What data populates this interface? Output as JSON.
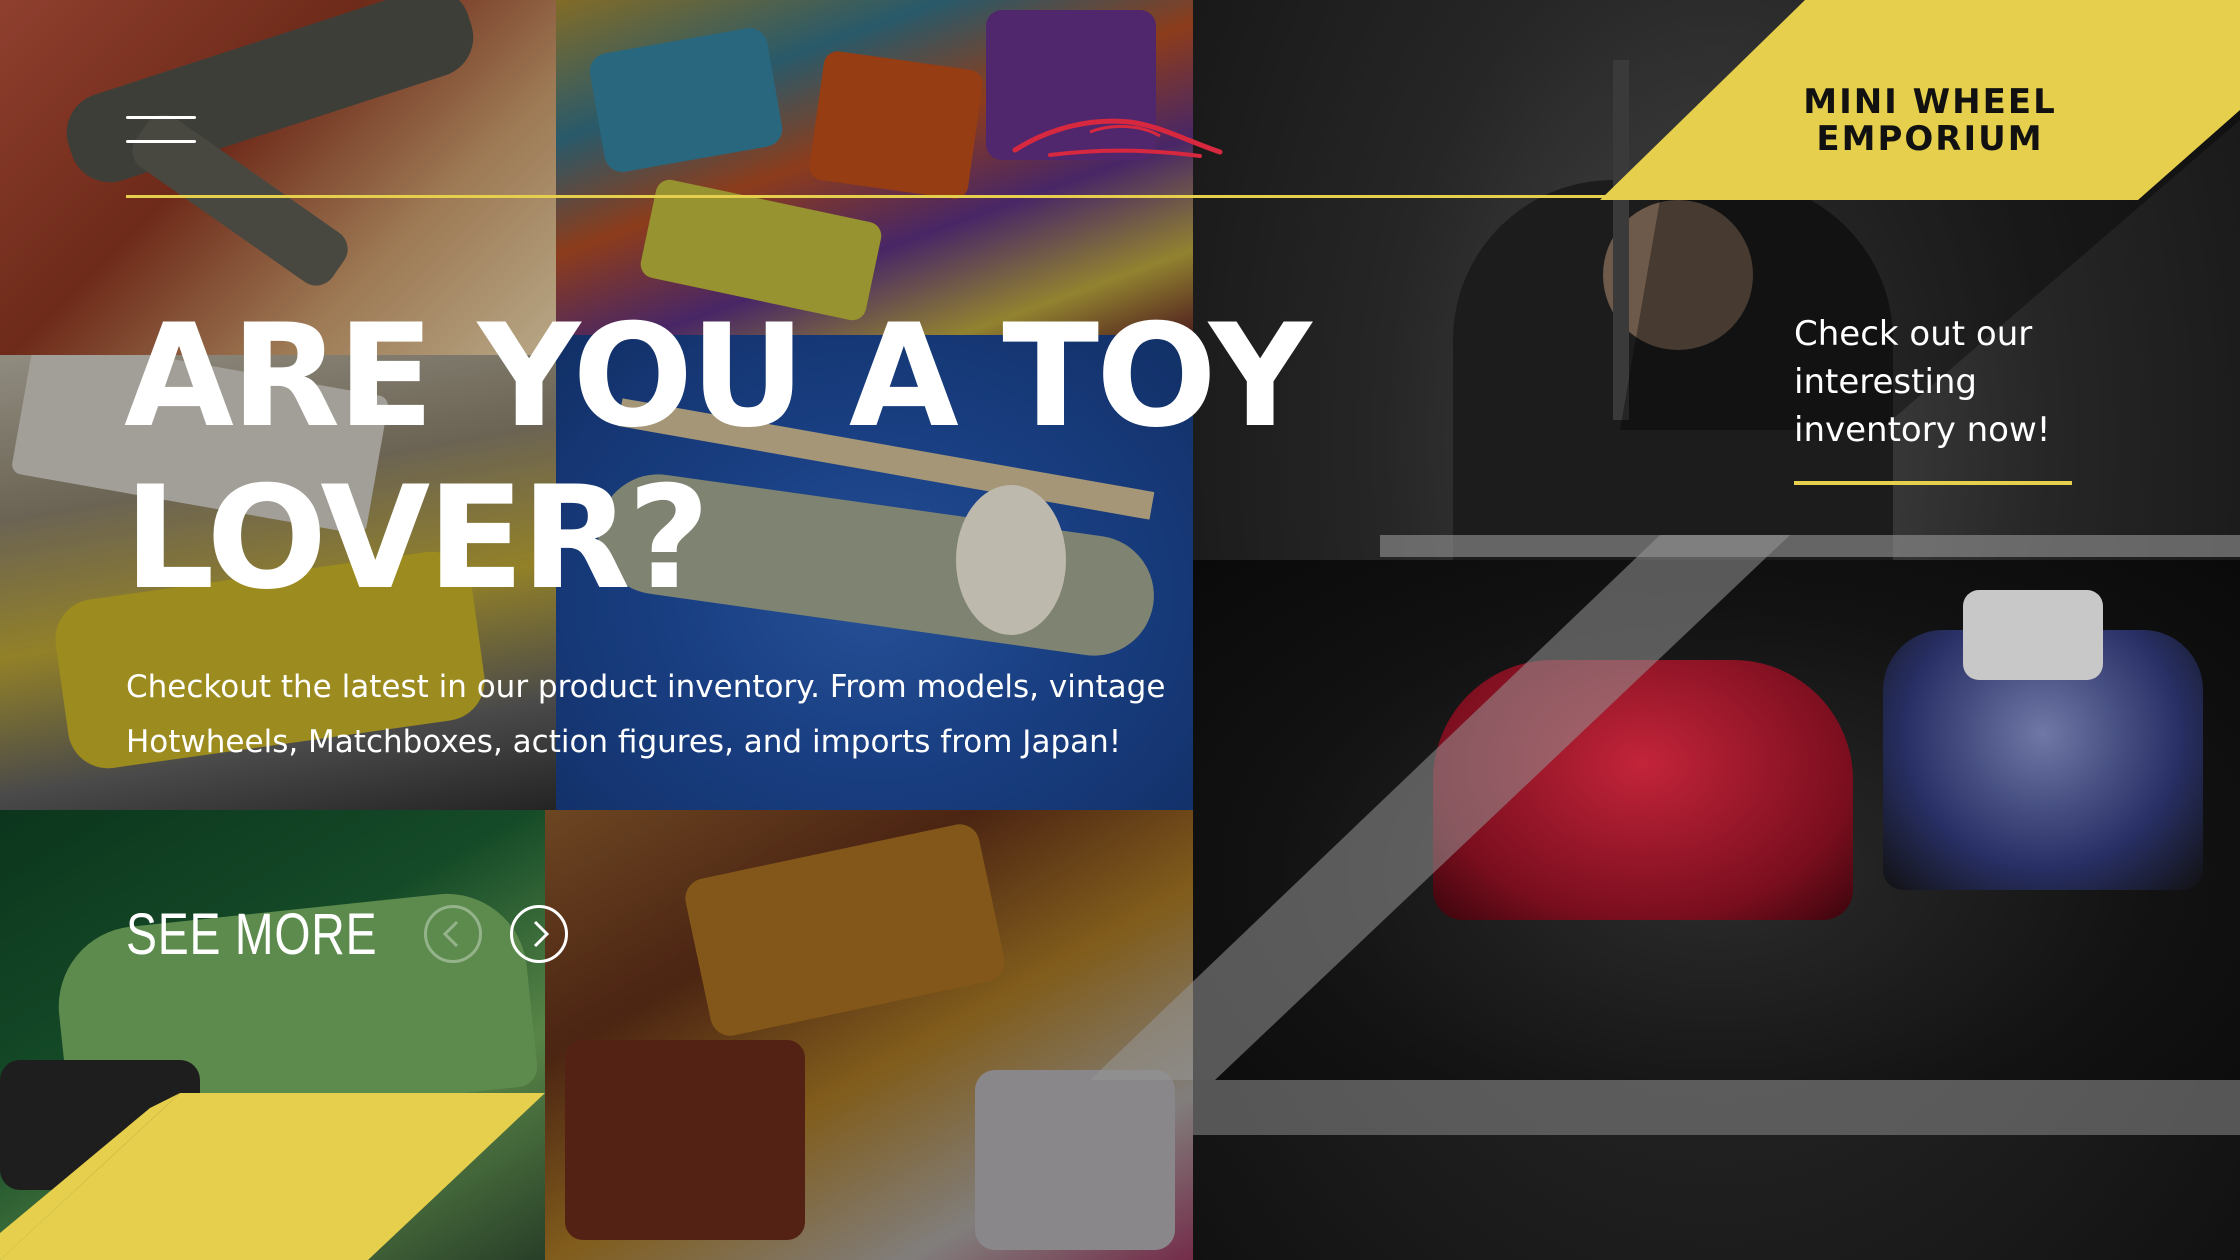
{
  "brand": {
    "name": "MINI WHEEL\nEMPORIUM",
    "accent_color": "#e6cf4c"
  },
  "header": {
    "menu_icon": "hamburger-menu-icon",
    "logo_icon": "car-silhouette-icon"
  },
  "hero": {
    "title": "ARE YOU A TOY\nLOVER?",
    "description": "Checkout the latest in our product inventory. From models, vintage Hotwheels, Matchboxes, action figures, and imports from Japan!",
    "see_more_label": "SEE MORE",
    "prev_icon": "chevron-left-icon",
    "next_icon": "chevron-right-icon"
  },
  "callout": {
    "text": "Check out our interesting inventory now!"
  }
}
